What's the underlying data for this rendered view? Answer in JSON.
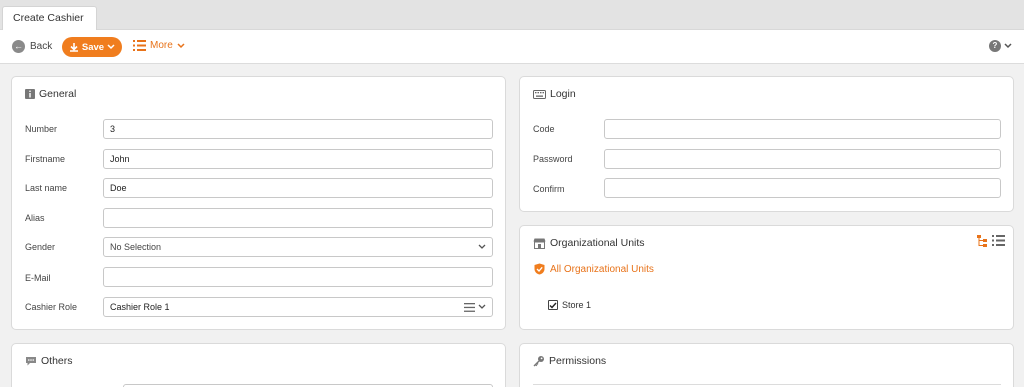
{
  "tabs": {
    "active": "Create Cashier"
  },
  "toolbar": {
    "back_label": "Back",
    "save_label": "Save",
    "more_label": "More"
  },
  "general": {
    "title": "General",
    "fields": {
      "number": {
        "label": "Number",
        "value": "3"
      },
      "firstname": {
        "label": "Firstname",
        "value": "John"
      },
      "lastname": {
        "label": "Last name",
        "value": "Doe"
      },
      "alias": {
        "label": "Alias",
        "value": ""
      },
      "gender": {
        "label": "Gender",
        "value": "No Selection"
      },
      "email": {
        "label": "E-Mail",
        "value": ""
      },
      "role": {
        "label": "Cashier Role",
        "value": "Cashier Role 1"
      }
    }
  },
  "login": {
    "title": "Login",
    "fields": {
      "code": {
        "label": "Code",
        "value": ""
      },
      "password": {
        "label": "Password",
        "value": ""
      },
      "confirm": {
        "label": "Confirm",
        "value": ""
      }
    }
  },
  "org_units": {
    "title": "Organizational Units",
    "all_label": "All Organizational Units",
    "items": [
      {
        "label": "Store 1",
        "checked": true
      }
    ]
  },
  "others": {
    "title": "Others"
  },
  "permissions": {
    "title": "Permissions"
  },
  "colors": {
    "accent": "#f07d1e",
    "accent_text": "#e8731a"
  }
}
